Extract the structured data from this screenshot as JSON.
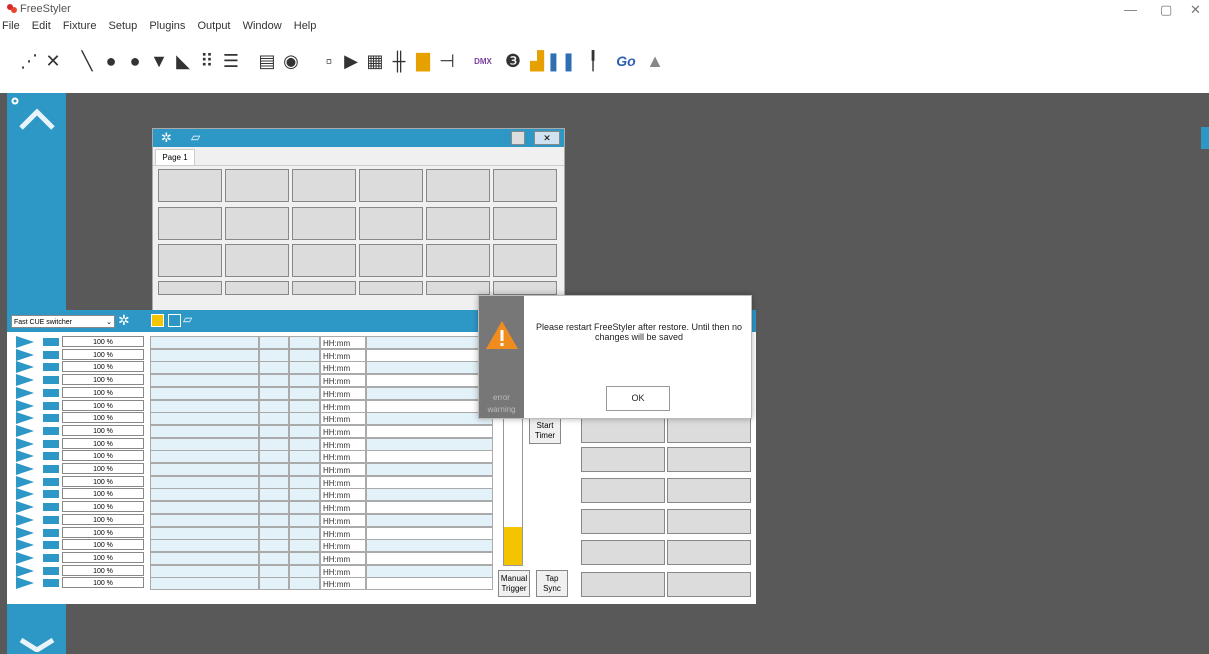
{
  "app": {
    "title": "FreeStyler"
  },
  "window_controls": {
    "minimize": "—",
    "restore": "▢",
    "close": "✕"
  },
  "menu": [
    "File",
    "Edit",
    "Fixture",
    "Setup",
    "Plugins",
    "Output",
    "Window",
    "Help"
  ],
  "toolbar": {
    "dmx_label": "DMX",
    "go_label": "Go"
  },
  "button_panel": {
    "tab": "Page 1"
  },
  "cue_panel": {
    "switcher_value": "Fast CUE switcher",
    "rows": [
      {
        "pct": "100 %",
        "time": "HH:mm"
      },
      {
        "pct": "100 %",
        "time": "HH:mm"
      },
      {
        "pct": "100 %",
        "time": "HH:mm"
      },
      {
        "pct": "100 %",
        "time": "HH:mm"
      },
      {
        "pct": "100 %",
        "time": "HH:mm"
      },
      {
        "pct": "100 %",
        "time": "HH:mm"
      },
      {
        "pct": "100 %",
        "time": "HH:mm"
      },
      {
        "pct": "100 %",
        "time": "HH:mm"
      },
      {
        "pct": "100 %",
        "time": "HH:mm"
      },
      {
        "pct": "100 %",
        "time": "HH:mm"
      },
      {
        "pct": "100 %",
        "time": "HH:mm"
      },
      {
        "pct": "100 %",
        "time": "HH:mm"
      },
      {
        "pct": "100 %",
        "time": "HH:mm"
      },
      {
        "pct": "100 %",
        "time": "HH:mm"
      },
      {
        "pct": "100 %",
        "time": "HH:mm"
      },
      {
        "pct": "100 %",
        "time": "HH:mm"
      },
      {
        "pct": "100 %",
        "time": "HH:mm"
      },
      {
        "pct": "100 %",
        "time": "HH:mm"
      },
      {
        "pct": "100 %",
        "time": "HH:mm"
      },
      {
        "pct": "100 %",
        "time": "HH:mm"
      }
    ],
    "start_timer": "Start Timer",
    "manual_trigger": "Manual Trigger",
    "tap_sync": "Tap Sync"
  },
  "dialog": {
    "message": "Please restart FreeStyler after restore. Until then no changes will be saved",
    "side_label_1": "error",
    "side_label_2": "warning",
    "ok_label": "OK"
  },
  "colors": {
    "accent": "#2d97c6",
    "workspace": "#595959",
    "warning": "#f08c1e",
    "fader": "#f5c400"
  }
}
